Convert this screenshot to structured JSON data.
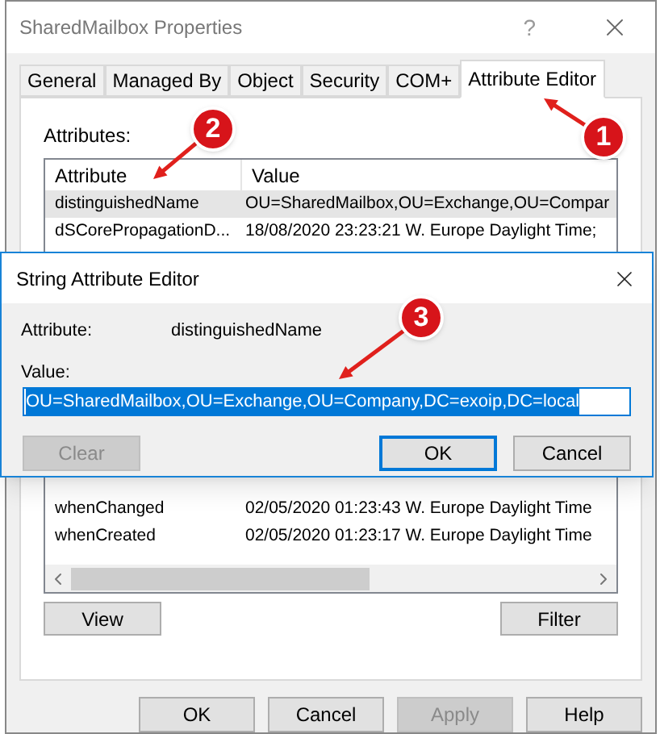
{
  "window": {
    "title": "SharedMailbox Properties",
    "help": "?"
  },
  "tabs": [
    {
      "label": "General",
      "selected": false
    },
    {
      "label": "Managed By",
      "selected": false
    },
    {
      "label": "Object",
      "selected": false
    },
    {
      "label": "Security",
      "selected": false
    },
    {
      "label": "COM+",
      "selected": false
    },
    {
      "label": "Attribute Editor",
      "selected": true
    }
  ],
  "attributes_label": "Attributes:",
  "table": {
    "columns": [
      "Attribute",
      "Value"
    ],
    "rows": [
      {
        "attribute": "distinguishedName",
        "value": "OU=SharedMailbox,OU=Exchange,OU=Compar",
        "selected": true
      },
      {
        "attribute": "dSCorePropagationD...",
        "value": "18/08/2020 23:23:21 W. Europe Daylight Time;",
        "selected": false
      },
      {
        "attribute": "whenChanged",
        "value": "02/05/2020 01:23:43 W. Europe Daylight Time",
        "selected": false
      },
      {
        "attribute": "whenCreated",
        "value": "02/05/2020 01:23:17 W. Europe Daylight Time",
        "selected": false
      }
    ]
  },
  "panel_buttons": [
    "View",
    "Filter"
  ],
  "footer_buttons": [
    {
      "label": "OK",
      "disabled": false
    },
    {
      "label": "Cancel",
      "disabled": false
    },
    {
      "label": "Apply",
      "disabled": true
    },
    {
      "label": "Help",
      "disabled": false
    }
  ],
  "dialog": {
    "title": "String Attribute Editor",
    "attribute_label": "Attribute:",
    "attribute_value": "distinguishedName",
    "value_label": "Value:",
    "value": "OU=SharedMailbox,OU=Exchange,OU=Company,DC=exoip,DC=local",
    "value_selected": true,
    "buttons": [
      {
        "label": "Clear",
        "disabled": true,
        "default": false
      },
      {
        "label": "OK",
        "disabled": false,
        "default": true
      },
      {
        "label": "Cancel",
        "disabled": false,
        "default": false
      }
    ]
  },
  "annotations": [
    {
      "label": "1"
    },
    {
      "label": "2"
    },
    {
      "label": "3"
    }
  ]
}
